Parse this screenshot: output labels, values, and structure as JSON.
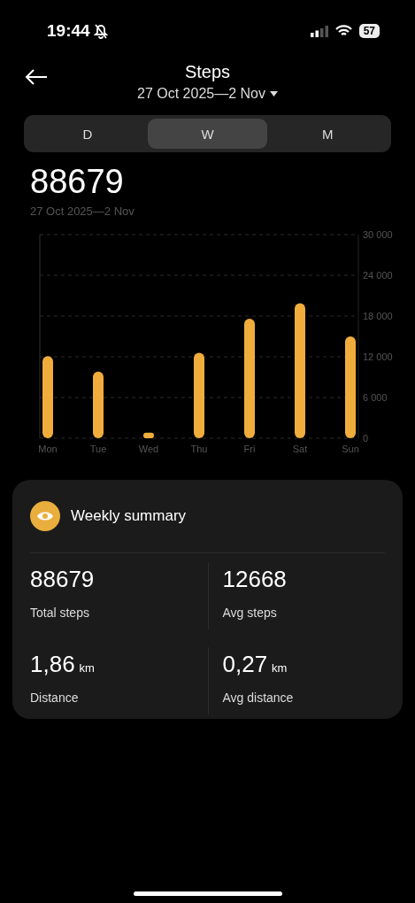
{
  "status_bar": {
    "time": "19:44",
    "silent": true,
    "battery": "57"
  },
  "header": {
    "title": "Steps",
    "range": "27 Oct 2025—2 Nov"
  },
  "tabs": [
    {
      "label": "D",
      "selected": false
    },
    {
      "label": "W",
      "selected": true
    },
    {
      "label": "M",
      "selected": false
    }
  ],
  "total": {
    "value": "88679",
    "range": "27 Oct 2025—2 Nov"
  },
  "chart_data": {
    "type": "bar",
    "categories": [
      "Mon",
      "Tue",
      "Wed",
      "Thu",
      "Fri",
      "Sat",
      "Sun"
    ],
    "grid": true,
    "series": [
      {
        "color": "#f0ad3c",
        "values": [
          12100,
          9800,
          800,
          12600,
          17600,
          19900,
          15000
        ]
      }
    ],
    "ylim": [
      0,
      30000
    ],
    "yticks": [
      {
        "value": 0,
        "label": "0"
      },
      {
        "value": 6000,
        "label": "6 000"
      },
      {
        "value": 12000,
        "label": "12 000"
      },
      {
        "value": 18000,
        "label": "18 000"
      },
      {
        "value": 24000,
        "label": "24 000"
      },
      {
        "value": 30000,
        "label": "30 000"
      }
    ]
  },
  "summary": {
    "title": "Weekly summary",
    "stats": [
      {
        "value": "88679",
        "label": "Total steps"
      },
      {
        "value": "12668",
        "label": "Avg steps"
      },
      {
        "value": "1,86",
        "unit": "km",
        "label": "Distance"
      },
      {
        "value": "0,27",
        "unit": "km",
        "label": "Avg distance"
      }
    ]
  }
}
